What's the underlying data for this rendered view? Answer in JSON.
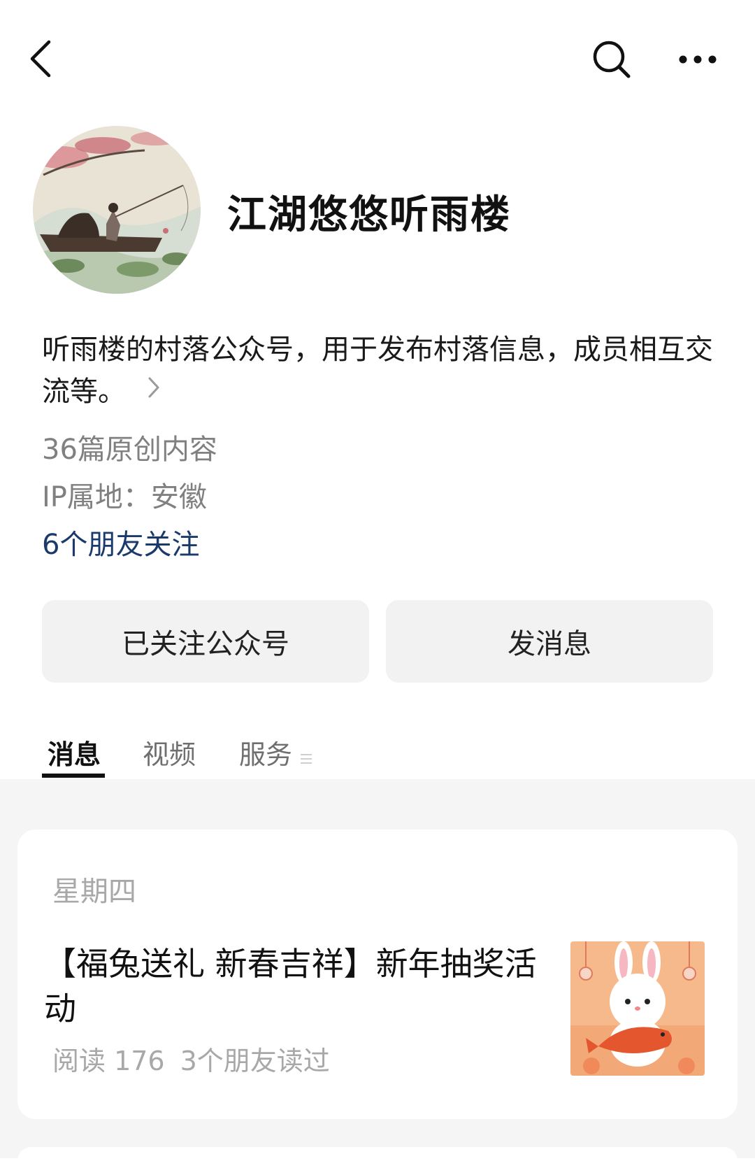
{
  "header": {
    "back_icon": "chevron-left-icon",
    "search_icon": "search-icon",
    "more_icon": "more-horizontal-icon"
  },
  "profile": {
    "name": "江湖悠悠听雨楼",
    "avatar_icon": "avatar-image",
    "description": "听雨楼的村落公众号，用于发布村落信息，成员相互交流等。",
    "original_count": "36篇原创内容",
    "ip_location": "IP属地：安徽",
    "friends_follow": "6个朋友关注"
  },
  "actions": {
    "followed_label": "已关注公众号",
    "message_label": "发消息"
  },
  "tabs": [
    {
      "label": "消息",
      "active": true
    },
    {
      "label": "视频",
      "active": false
    },
    {
      "label": "服务",
      "active": false
    }
  ],
  "feed": {
    "day": "星期四",
    "article": {
      "title": "【福兔送礼 新春吉祥】新年抽奖活动",
      "reads": "阅读 176",
      "friends_read": "3个朋友读过",
      "thumbnail_icon": "rabbit-with-koi-image"
    }
  },
  "colors": {
    "link_blue": "#1a3a6b",
    "button_bg": "#f2f2f2",
    "feed_bg": "#f5f5f5",
    "muted_text": "#a8a8a8"
  }
}
